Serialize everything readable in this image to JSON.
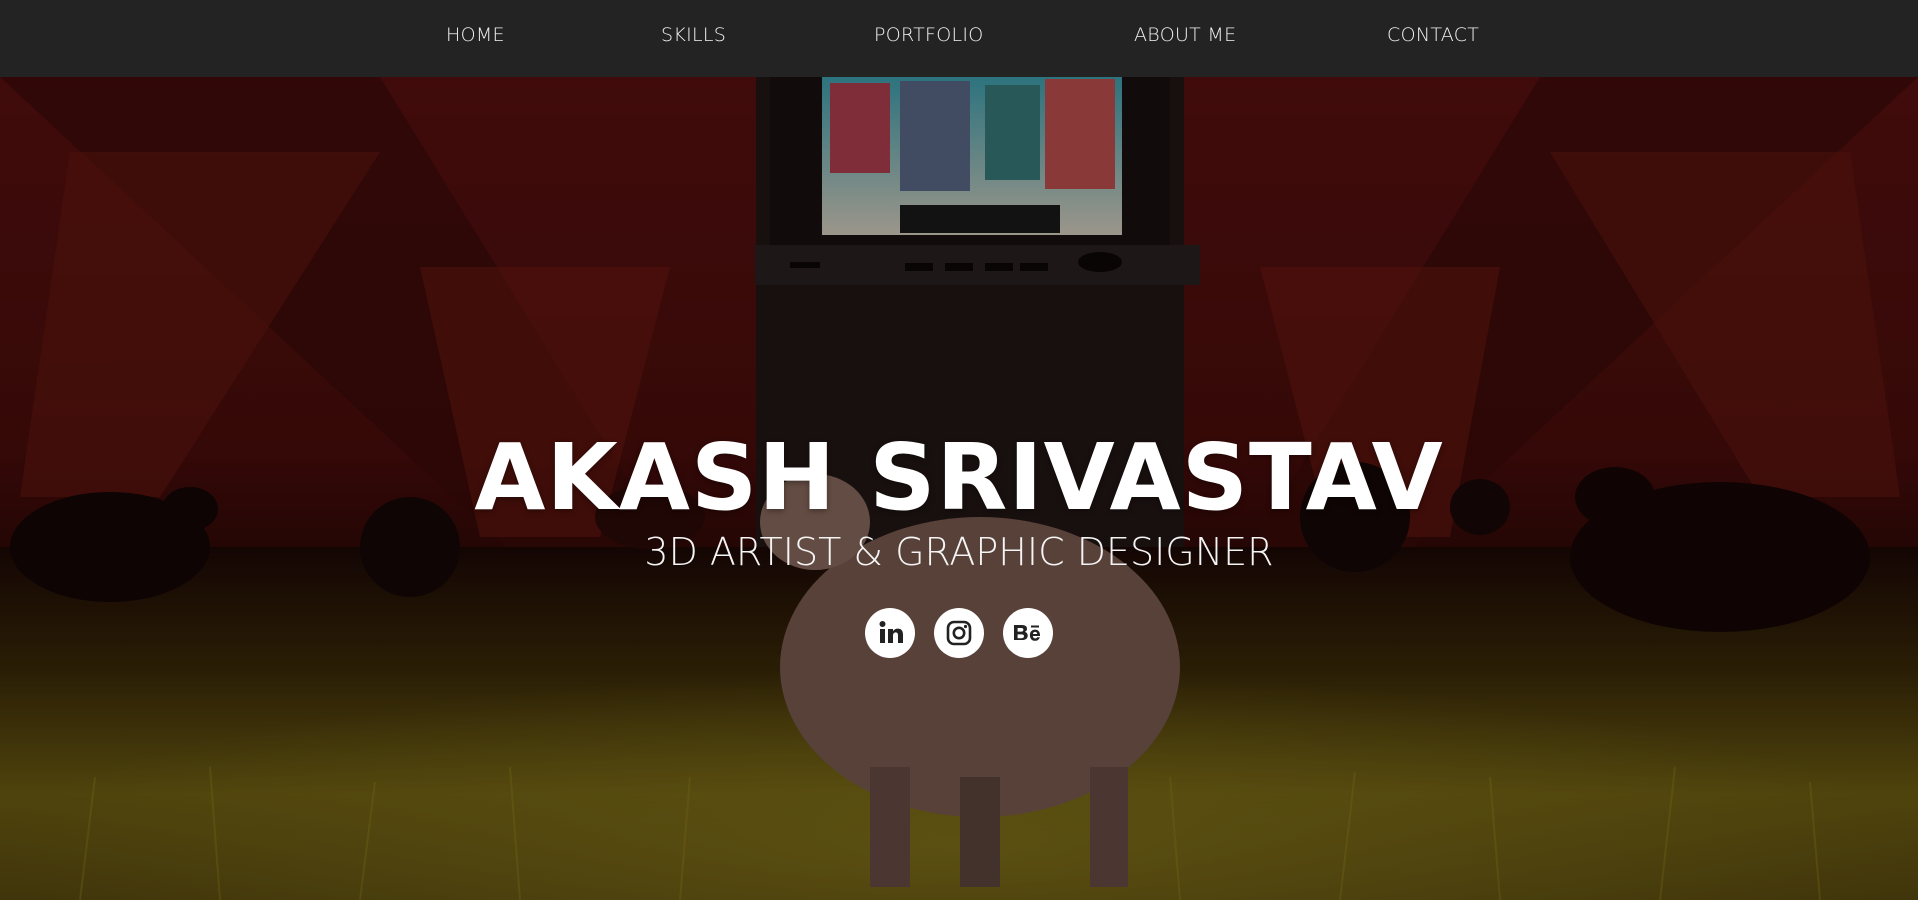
{
  "nav": {
    "items": [
      {
        "label": "HOME"
      },
      {
        "label": "SKILLS"
      },
      {
        "label": "PORTFOLIO"
      },
      {
        "label": "ABOUT ME"
      },
      {
        "label": "CONTACT"
      }
    ]
  },
  "hero": {
    "name": "AKASH SRIVASTAV",
    "tagline": "3D ARTIST & GRAPHIC DESIGNER"
  },
  "socials": [
    {
      "icon": "linkedin-icon"
    },
    {
      "icon": "instagram-icon"
    },
    {
      "icon": "behance-icon"
    }
  ],
  "colors": {
    "nav_bg": "#232323",
    "nav_text": "#f2f2f2",
    "hero_red": "#7a1410",
    "grass": "#8a7a1a",
    "text": "#ffffff"
  }
}
